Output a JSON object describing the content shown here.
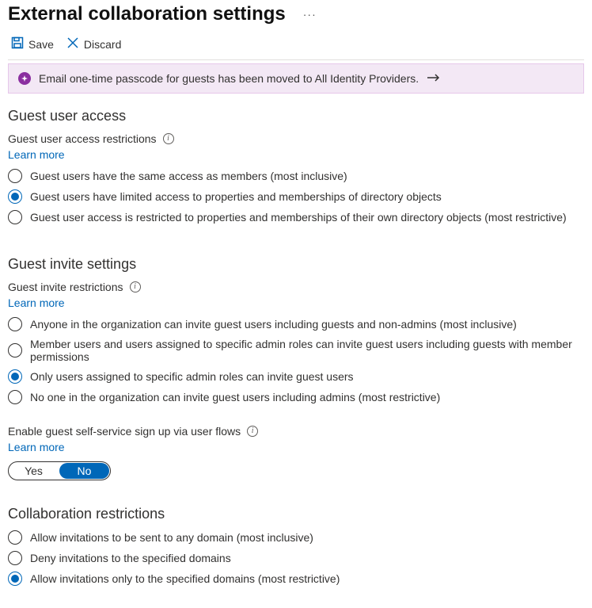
{
  "header": {
    "title": "External collaboration settings",
    "more": "···"
  },
  "toolbar": {
    "save_label": "Save",
    "discard_label": "Discard"
  },
  "notice": {
    "text": "Email one-time passcode for guests has been moved to All Identity Providers."
  },
  "sections": {
    "guest_access": {
      "title": "Guest user access",
      "field_label": "Guest user access restrictions",
      "learn_more": "Learn more",
      "options": [
        "Guest users have the same access as members (most inclusive)",
        "Guest users have limited access to properties and memberships of directory objects",
        "Guest user access is restricted to properties and memberships of their own directory objects (most restrictive)"
      ],
      "selected_index": 1
    },
    "guest_invite": {
      "title": "Guest invite settings",
      "field_label": "Guest invite restrictions",
      "learn_more": "Learn more",
      "options": [
        "Anyone in the organization can invite guest users including guests and non-admins (most inclusive)",
        "Member users and users assigned to specific admin roles can invite guest users including guests with member permissions",
        "Only users assigned to specific admin roles can invite guest users",
        "No one in the organization can invite guest users including admins (most restrictive)"
      ],
      "selected_index": 2
    },
    "self_service": {
      "label": "Enable guest self-service sign up via user flows",
      "learn_more": "Learn more",
      "yes": "Yes",
      "no": "No",
      "value": "No"
    },
    "collab_restrictions": {
      "title": "Collaboration restrictions",
      "options": [
        "Allow invitations to be sent to any domain (most inclusive)",
        "Deny invitations to the specified domains",
        "Allow invitations only to the specified domains (most restrictive)"
      ],
      "selected_index": 2
    }
  }
}
